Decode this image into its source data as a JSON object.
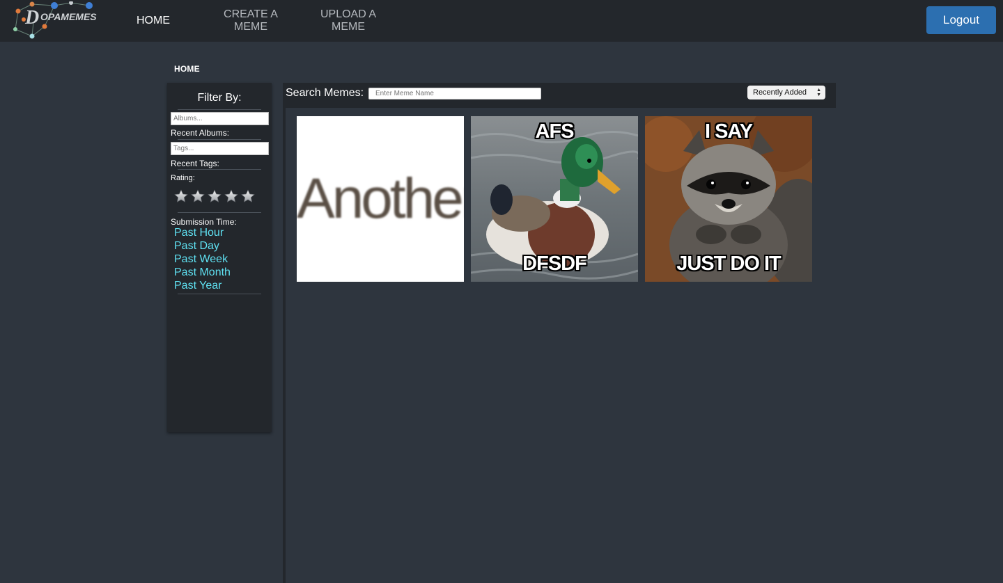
{
  "nav": {
    "brand": "DOPAMEMES",
    "brand_initial": "D",
    "brand_rest": "OPAMEMES",
    "home": "HOME",
    "create_line1": "CREATE A",
    "create_line2": "MEME",
    "upload_line1": "UPLOAD A",
    "upload_line2": "MEME",
    "logout": "Logout"
  },
  "breadcrumb": "HOME",
  "sidebar": {
    "title": "Filter By:",
    "albums_placeholder": "Albums...",
    "recent_albums": "Recent Albums:",
    "tags_placeholder": "Tags...",
    "recent_tags": "Recent Tags:",
    "rating_label": "Rating:",
    "rating_stars": 5,
    "submission_label": "Submission Time:",
    "time_filters": [
      "Past Hour",
      "Past Day",
      "Past Week",
      "Past Month",
      "Past Year"
    ]
  },
  "search": {
    "label": "Search Memes:",
    "placeholder": "Enter Meme Name",
    "sort": "Recently Added"
  },
  "memes": [
    {
      "text": "Another"
    },
    {
      "top": "AFS",
      "bottom": "DFSDF"
    },
    {
      "top": "I SAY",
      "bottom": "JUST DO IT"
    }
  ],
  "colors": {
    "accent_link": "#5fe1f2",
    "logout_bg": "#2c6fb0",
    "page_bg": "#2e353e",
    "panel_bg": "#23272c"
  },
  "icons": {
    "logo": "molecule-logo-icon",
    "rating": "star-icon",
    "sort": "select-arrows-icon"
  }
}
